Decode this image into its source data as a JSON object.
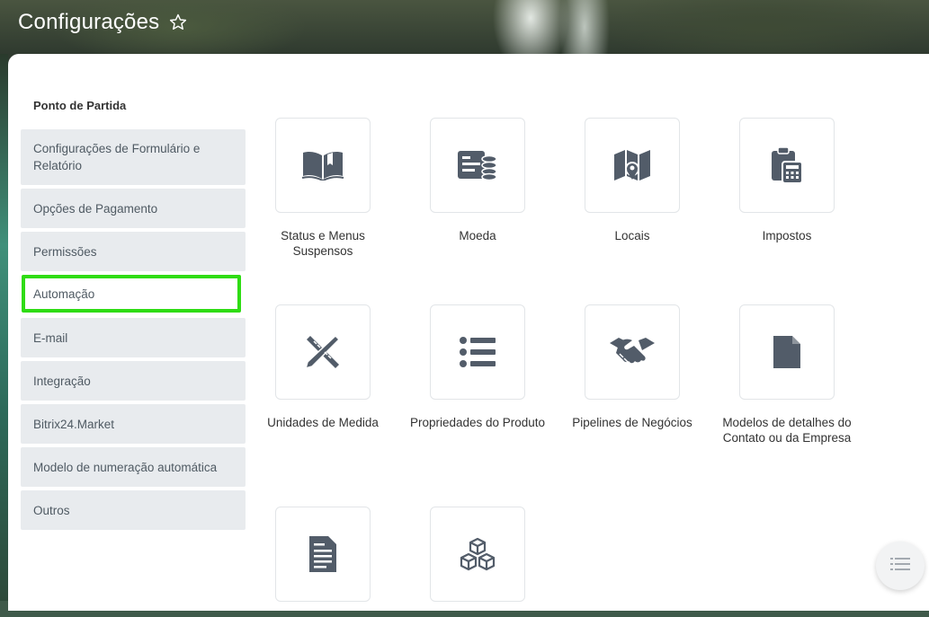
{
  "page": {
    "title": "Configurações"
  },
  "colors": {
    "highlight": "#2fdc14",
    "icon": "#525c69",
    "sidebar_bg": "#e8ebee"
  },
  "sidebar": {
    "heading": "Ponto de Partida",
    "items": [
      {
        "label": "Configurações de Formulário e Relatório"
      },
      {
        "label": "Opções de Pagamento"
      },
      {
        "label": "Permissões"
      },
      {
        "label": "Automação",
        "highlighted": true
      },
      {
        "label": "E-mail"
      },
      {
        "label": "Integração"
      },
      {
        "label": "Bitrix24.Market"
      },
      {
        "label": "Modelo de numeração automática"
      },
      {
        "label": "Outros"
      }
    ]
  },
  "tiles": [
    {
      "label": "Status e Menus Suspensos",
      "icon": "open-book-icon"
    },
    {
      "label": "Moeda",
      "icon": "currency-coins-icon"
    },
    {
      "label": "Locais",
      "icon": "map-pin-icon"
    },
    {
      "label": "Impostos",
      "icon": "calculator-clipboard-icon"
    },
    {
      "label": "Unidades de Medida",
      "icon": "ruler-pencil-icon"
    },
    {
      "label": "Propriedades do Produto",
      "icon": "list-icon"
    },
    {
      "label": "Pipelines de Negócios",
      "icon": "handshake-icon"
    },
    {
      "label": "Modelos de detalhes do Contato ou da Empresa",
      "icon": "document-icon"
    },
    {
      "label": "",
      "icon": "text-document-icon"
    },
    {
      "label": "",
      "icon": "cubes-icon"
    }
  ]
}
